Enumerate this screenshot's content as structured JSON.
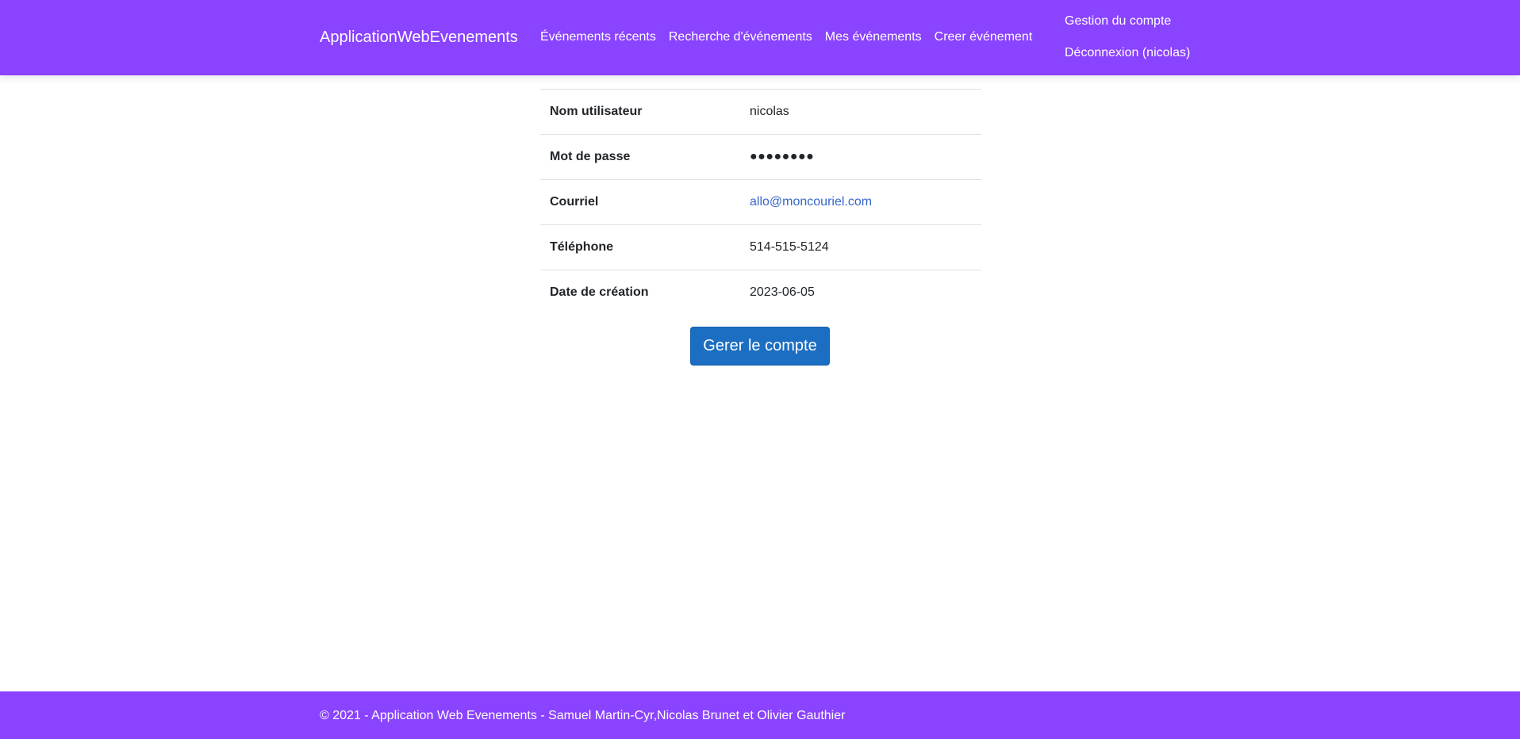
{
  "navbar": {
    "brand": "ApplicationWebEvenements",
    "links": [
      "Événements récents",
      "Recherche d'événements",
      "Mes événements",
      "Creer événement"
    ],
    "account": "Gestion du compte",
    "logout": "Déconnexion (nicolas)"
  },
  "account": {
    "rows": [
      {
        "label": "Nom utilisateur",
        "value": "nicolas"
      },
      {
        "label": "Mot de passe",
        "value": "●●●●●●●●"
      },
      {
        "label": "Courriel",
        "value": "allo@moncouriel.com"
      },
      {
        "label": "Téléphone",
        "value": "514-515-5124"
      },
      {
        "label": "Date de création",
        "value": "2023-06-05"
      }
    ],
    "manage_button": "Gerer le compte"
  },
  "footer": {
    "text": "© 2021 - Application Web Evenements - Samuel Martin-Cyr,Nicolas Brunet et Olivier Gauthier"
  },
  "colors": {
    "primary": "#8a43ff",
    "button": "#1b6ec2",
    "link": "#3766c8"
  }
}
